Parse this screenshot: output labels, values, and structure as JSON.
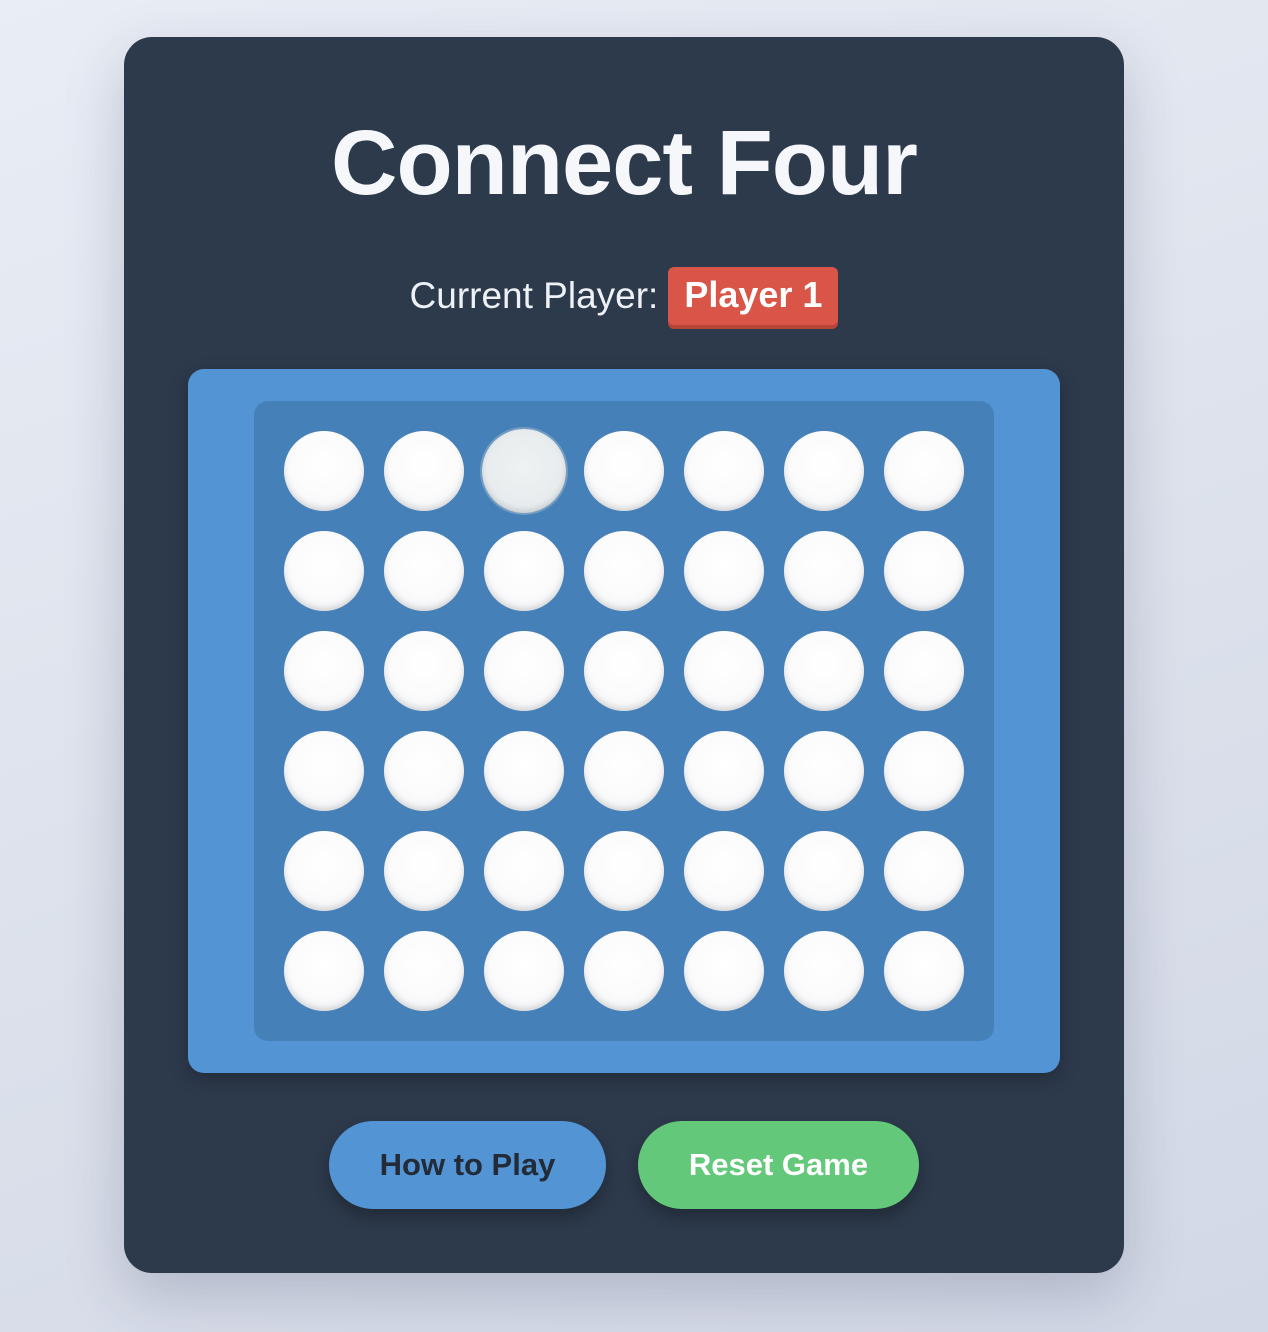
{
  "game": {
    "title": "Connect Four",
    "status_label": "Current Player:",
    "current_player": "Player 1",
    "rows": 6,
    "columns": 7,
    "hover_column": 3,
    "board": [
      [
        "empty",
        "empty",
        "empty",
        "empty",
        "empty",
        "empty",
        "empty"
      ],
      [
        "empty",
        "empty",
        "empty",
        "empty",
        "empty",
        "empty",
        "empty"
      ],
      [
        "empty",
        "empty",
        "empty",
        "empty",
        "empty",
        "empty",
        "empty"
      ],
      [
        "empty",
        "empty",
        "empty",
        "empty",
        "empty",
        "empty",
        "empty"
      ],
      [
        "empty",
        "empty",
        "empty",
        "empty",
        "empty",
        "empty",
        "empty"
      ],
      [
        "empty",
        "empty",
        "empty",
        "empty",
        "empty",
        "empty",
        "empty"
      ]
    ]
  },
  "buttons": {
    "how_to_play": "How to Play",
    "reset": "Reset Game"
  },
  "colors": {
    "card": "#2d3a4c",
    "board_outer": "#5294d4",
    "board_inner": "#4680b9",
    "player1": "#d95548",
    "help_button": "#5294d4",
    "reset_button": "#64c87b"
  }
}
